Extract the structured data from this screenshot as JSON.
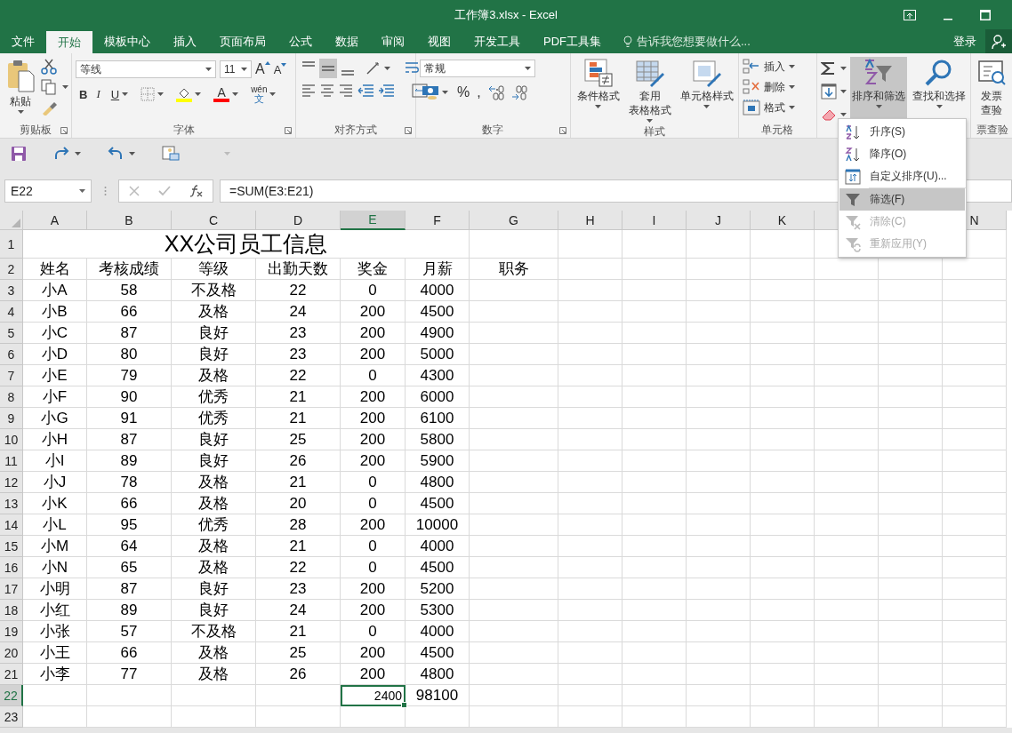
{
  "window": {
    "title": "工作簿3.xlsx - Excel"
  },
  "tabs": [
    {
      "label": "文件",
      "selected": false
    },
    {
      "label": "开始",
      "selected": true
    },
    {
      "label": "模板中心",
      "selected": false
    },
    {
      "label": "插入",
      "selected": false
    },
    {
      "label": "页面布局",
      "selected": false
    },
    {
      "label": "公式",
      "selected": false
    },
    {
      "label": "数据",
      "selected": false
    },
    {
      "label": "审阅",
      "selected": false
    },
    {
      "label": "视图",
      "selected": false
    },
    {
      "label": "开发工具",
      "selected": false
    },
    {
      "label": "PDF工具集",
      "selected": false
    }
  ],
  "tell_me": {
    "placeholder": "告诉我您想要做什么..."
  },
  "account": {
    "sign_in": "登录"
  },
  "ribbon": {
    "clipboard": {
      "paste": "粘贴",
      "group": "剪贴板"
    },
    "font": {
      "name": "等线",
      "size": "11",
      "grow": "A",
      "shrink": "A",
      "bold": "B",
      "italic": "I",
      "underline": "U",
      "font_color": "A",
      "phonetic_top": "wén",
      "phonetic_bottom": "文",
      "group": "字体"
    },
    "alignment": {
      "group": "对齐方式",
      "vertical": [
        {
          "kind": "top",
          "selected": false
        },
        {
          "kind": "middle",
          "selected": true
        },
        {
          "kind": "bottom",
          "selected": false
        }
      ]
    },
    "number": {
      "format": "常规",
      "percent": "%",
      "comma": ",",
      "group": "数字"
    },
    "styles": {
      "items": [
        {
          "kind": "conditional",
          "lines": [
            "条件格式"
          ]
        },
        {
          "kind": "table",
          "lines": [
            "套用",
            "表格格式"
          ]
        },
        {
          "kind": "cell",
          "lines": [
            "单元格样式"
          ]
        }
      ],
      "group": "样式"
    },
    "cells": {
      "items": [
        {
          "kind": "insert",
          "label": "插入"
        },
        {
          "kind": "delete",
          "label": "删除"
        },
        {
          "kind": "format",
          "label": "格式"
        }
      ],
      "group": "单元格"
    },
    "editing": {
      "items": [
        {
          "kind": "sort",
          "label": "排序和筛选",
          "pressed": true
        },
        {
          "kind": "find",
          "label": "查找和选择",
          "pressed": false
        }
      ]
    },
    "invoice": {
      "lines": [
        "发票",
        "查验"
      ],
      "group": "票查验"
    }
  },
  "name_box": "E22",
  "formula": "=SUM(E3:E21)",
  "sheet": {
    "columns": [
      {
        "label": "A",
        "selected": false
      },
      {
        "label": "B",
        "selected": false
      },
      {
        "label": "C",
        "selected": false
      },
      {
        "label": "D",
        "selected": false
      },
      {
        "label": "E",
        "selected": true
      },
      {
        "label": "F",
        "selected": false
      },
      {
        "label": "G",
        "selected": false
      },
      {
        "label": "H",
        "selected": false
      },
      {
        "label": "I",
        "selected": false
      },
      {
        "label": "J",
        "selected": false
      },
      {
        "label": "K",
        "selected": false
      },
      {
        "label": "N",
        "selected": false
      }
    ],
    "row_headers": [
      {
        "label": "1",
        "selected": false
      },
      {
        "label": "2",
        "selected": false
      },
      {
        "label": "3",
        "selected": false
      },
      {
        "label": "4",
        "selected": false
      },
      {
        "label": "5",
        "selected": false
      },
      {
        "label": "6",
        "selected": false
      },
      {
        "label": "7",
        "selected": false
      },
      {
        "label": "8",
        "selected": false
      },
      {
        "label": "9",
        "selected": false
      },
      {
        "label": "10",
        "selected": false
      },
      {
        "label": "11",
        "selected": false
      },
      {
        "label": "12",
        "selected": false
      },
      {
        "label": "13",
        "selected": false
      },
      {
        "label": "14",
        "selected": false
      },
      {
        "label": "15",
        "selected": false
      },
      {
        "label": "16",
        "selected": false
      },
      {
        "label": "17",
        "selected": false
      },
      {
        "label": "18",
        "selected": false
      },
      {
        "label": "19",
        "selected": false
      },
      {
        "label": "20",
        "selected": false
      },
      {
        "label": "21",
        "selected": false
      },
      {
        "label": "22",
        "selected": true
      },
      {
        "label": "23",
        "selected": false
      }
    ],
    "title": "XX公司员工信息",
    "header": [
      "姓名",
      "考核成绩",
      "等级",
      "出勤天数",
      "奖金",
      "月薪",
      "职务"
    ],
    "records": [
      [
        "小A",
        "58",
        "不及格",
        "22",
        "0",
        "4000"
      ],
      [
        "小B",
        "66",
        "及格",
        "24",
        "200",
        "4500"
      ],
      [
        "小C",
        "87",
        "良好",
        "23",
        "200",
        "4900"
      ],
      [
        "小D",
        "80",
        "良好",
        "23",
        "200",
        "5000"
      ],
      [
        "小E",
        "79",
        "及格",
        "22",
        "0",
        "4300"
      ],
      [
        "小F",
        "90",
        "优秀",
        "21",
        "200",
        "6000"
      ],
      [
        "小G",
        "91",
        "优秀",
        "21",
        "200",
        "6100"
      ],
      [
        "小H",
        "87",
        "良好",
        "25",
        "200",
        "5800"
      ],
      [
        "小I",
        "89",
        "良好",
        "26",
        "200",
        "5900"
      ],
      [
        "小J",
        "78",
        "及格",
        "21",
        "0",
        "4800"
      ],
      [
        "小K",
        "66",
        "及格",
        "20",
        "0",
        "4500"
      ],
      [
        "小L",
        "95",
        "优秀",
        "28",
        "200",
        "10000"
      ],
      [
        "小M",
        "64",
        "及格",
        "21",
        "0",
        "4000"
      ],
      [
        "小N",
        "65",
        "及格",
        "22",
        "0",
        "4500"
      ],
      [
        "小明",
        "87",
        "良好",
        "23",
        "200",
        "5200"
      ],
      [
        "小红",
        "89",
        "良好",
        "24",
        "200",
        "5300"
      ],
      [
        "小张",
        "57",
        "不及格",
        "21",
        "0",
        "4000"
      ],
      [
        "小王",
        "66",
        "及格",
        "25",
        "200",
        "4500"
      ],
      [
        "小李",
        "77",
        "及格",
        "26",
        "200",
        "4800"
      ]
    ],
    "totals": {
      "bonus": "2400",
      "salary": "98100"
    }
  },
  "sort_menu": {
    "items": [
      {
        "kind": "ascending",
        "label": "升序(S)",
        "highlighted": false,
        "disabled": false,
        "separator_before": false
      },
      {
        "kind": "descending",
        "label": "降序(O)",
        "highlighted": false,
        "disabled": false,
        "separator_before": false
      },
      {
        "kind": "custom",
        "label": "自定义排序(U)...",
        "highlighted": false,
        "disabled": false,
        "separator_before": false
      },
      {
        "kind": "filter",
        "label": "筛选(F)",
        "highlighted": true,
        "disabled": false,
        "separator_before": true
      },
      {
        "kind": "clear",
        "label": "清除(C)",
        "highlighted": false,
        "disabled": true,
        "separator_before": false
      },
      {
        "kind": "reapply",
        "label": "重新应用(Y)",
        "highlighted": false,
        "disabled": true,
        "separator_before": false
      }
    ]
  }
}
